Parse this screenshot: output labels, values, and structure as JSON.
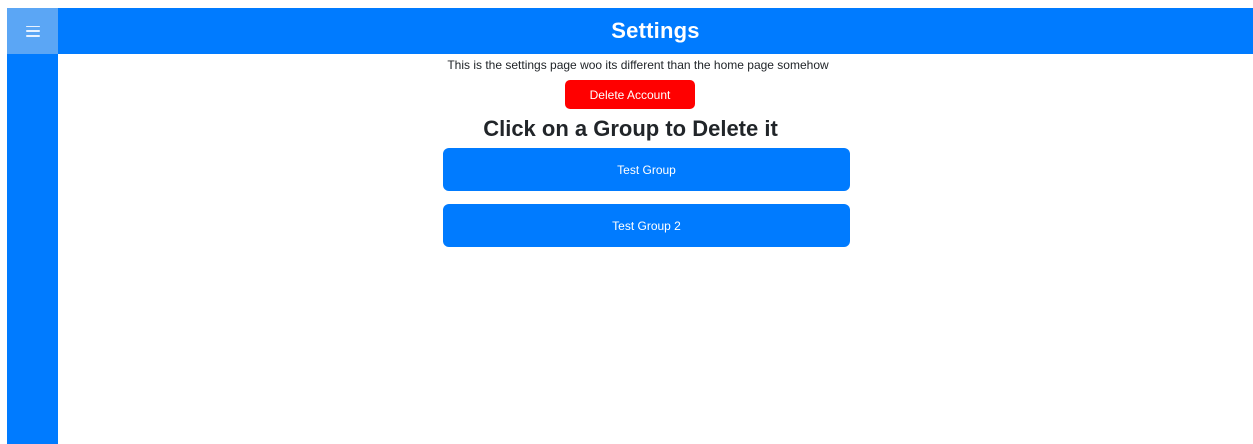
{
  "header": {
    "title": "Settings"
  },
  "sidebar": {
    "menu_icon": "hamburger-menu-icon"
  },
  "main": {
    "intro_text": "This is the settings page woo its different than the home page somehow",
    "delete_account_label": "Delete Account",
    "groups_heading": "Click on a Group to Delete it",
    "groups": [
      {
        "label": "Test Group"
      },
      {
        "label": "Test Group 2"
      }
    ]
  },
  "colors": {
    "primary": "#007bff",
    "menu_toggle": "#5ba6f5",
    "danger": "#ff0000",
    "text": "#212529",
    "background": "#ffffff"
  }
}
